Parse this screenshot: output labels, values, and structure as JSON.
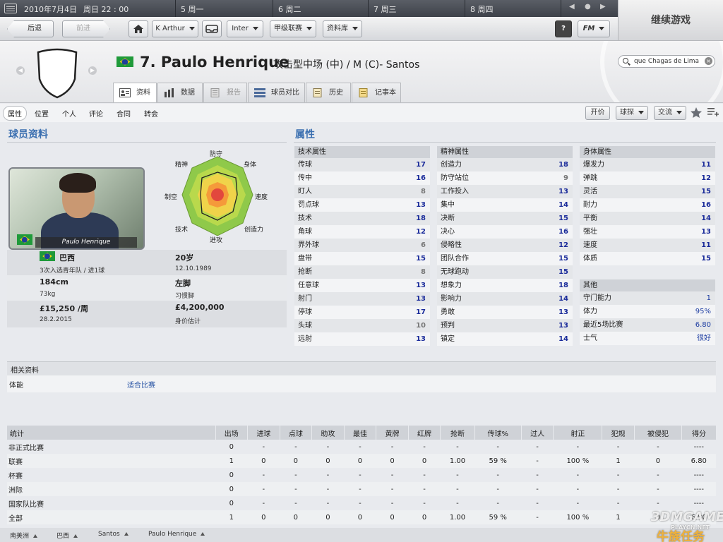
{
  "topbar": {
    "date": "2010年7月4日",
    "time": "周日 22 : 00",
    "days": [
      "5 周一",
      "6 周二",
      "7 周三",
      "8 周四"
    ],
    "continue_label": "继续游戏"
  },
  "toolbar": {
    "back": "后退",
    "forward": "前进",
    "manager": "K Arthur",
    "club": "Inter",
    "league": "甲级联赛",
    "database": "资料库",
    "help": "?",
    "fm": "FM"
  },
  "player": {
    "name": "7. Paulo Henrique",
    "position_club": "攻击型中场 (中) / M (C)- Santos",
    "photo_caption": "Paulo Henrique"
  },
  "search": {
    "value": "que Chagas de Lima"
  },
  "tabs": [
    "资料",
    "数据",
    "报告",
    "球员对比",
    "历史",
    "记事本"
  ],
  "subnav": {
    "items": [
      "属性",
      "位置",
      "个人",
      "评论",
      "合同",
      "转会"
    ],
    "offer": "开价",
    "scout": "球探",
    "interact": "交流"
  },
  "profile": {
    "title": "球员资料",
    "nationality": "巴西",
    "caps": "3次入选青年队 / 进1球",
    "age": "20岁",
    "dob": "12.10.1989",
    "height": "184cm",
    "weight": "73kg",
    "foot": "左脚",
    "foot_label": "习惯脚",
    "wage": "£15,250 /周",
    "contract_end": "28.2.2015",
    "value": "£4,200,000",
    "value_label": "身价估计"
  },
  "radar": {
    "labels": {
      "defend": "防守",
      "physical": "身体",
      "speed": "速度",
      "creativity": "创造力",
      "attack": "进攻",
      "technique": "技术",
      "aerial": "制空",
      "mental": "精神"
    }
  },
  "attributes": {
    "title": "属性",
    "technical": {
      "title": "技术属性",
      "items": [
        {
          "n": "传球",
          "v": "17"
        },
        {
          "n": "传中",
          "v": "16"
        },
        {
          "n": "盯人",
          "v": "8"
        },
        {
          "n": "罚点球",
          "v": "13"
        },
        {
          "n": "技术",
          "v": "18"
        },
        {
          "n": "角球",
          "v": "12"
        },
        {
          "n": "界外球",
          "v": "6"
        },
        {
          "n": "盘带",
          "v": "15"
        },
        {
          "n": "抢断",
          "v": "8"
        },
        {
          "n": "任意球",
          "v": "13"
        },
        {
          "n": "射门",
          "v": "13"
        },
        {
          "n": "停球",
          "v": "17"
        },
        {
          "n": "头球",
          "v": "10"
        },
        {
          "n": "远射",
          "v": "13"
        }
      ]
    },
    "mental": {
      "title": "精神属性",
      "items": [
        {
          "n": "创造力",
          "v": "18"
        },
        {
          "n": "防守站位",
          "v": "9"
        },
        {
          "n": "工作投入",
          "v": "13"
        },
        {
          "n": "集中",
          "v": "14"
        },
        {
          "n": "决断",
          "v": "15"
        },
        {
          "n": "决心",
          "v": "16"
        },
        {
          "n": "侵略性",
          "v": "12"
        },
        {
          "n": "团队合作",
          "v": "15"
        },
        {
          "n": "无球跑动",
          "v": "15"
        },
        {
          "n": "想象力",
          "v": "18"
        },
        {
          "n": "影响力",
          "v": "14"
        },
        {
          "n": "勇敢",
          "v": "13"
        },
        {
          "n": "预判",
          "v": "13"
        },
        {
          "n": "镇定",
          "v": "14"
        }
      ]
    },
    "physical": {
      "title": "身体属性",
      "items": [
        {
          "n": "爆发力",
          "v": "11"
        },
        {
          "n": "弹跳",
          "v": "12"
        },
        {
          "n": "灵活",
          "v": "15"
        },
        {
          "n": "耐力",
          "v": "16"
        },
        {
          "n": "平衡",
          "v": "14"
        },
        {
          "n": "强壮",
          "v": "13"
        },
        {
          "n": "速度",
          "v": "11"
        },
        {
          "n": "体质",
          "v": "15"
        }
      ]
    },
    "other": {
      "title": "其他",
      "items": [
        {
          "n": "守门能力",
          "v": "1"
        },
        {
          "n": "体力",
          "v": "95%"
        },
        {
          "n": "最近5场比赛",
          "v": "6.80"
        },
        {
          "n": "士气",
          "v": "很好"
        }
      ]
    }
  },
  "related": {
    "title": "相关资料",
    "label": "体能",
    "value": "适合比赛"
  },
  "stats": {
    "headers": [
      "统计",
      "出场",
      "进球",
      "点球",
      "助攻",
      "最佳",
      "黄牌",
      "红牌",
      "抢断",
      "传球%",
      "过人",
      "射正",
      "犯规",
      "被侵犯",
      "得分"
    ],
    "rows": [
      [
        "非正式比赛",
        "0",
        "-",
        "-",
        "-",
        "-",
        "-",
        "-",
        "-",
        "-",
        "-",
        "-",
        "-",
        "-",
        "----"
      ],
      [
        "联赛",
        "1",
        "0",
        "0",
        "0",
        "0",
        "0",
        "0",
        "1.00",
        "59 %",
        "-",
        "100 %",
        "1",
        "0",
        "6.80"
      ],
      [
        "杯赛",
        "0",
        "-",
        "-",
        "-",
        "-",
        "-",
        "-",
        "-",
        "-",
        "-",
        "-",
        "-",
        "-",
        "----"
      ],
      [
        "洲际",
        "0",
        "-",
        "-",
        "-",
        "-",
        "-",
        "-",
        "-",
        "-",
        "-",
        "-",
        "-",
        "-",
        "----"
      ],
      [
        "国家队比赛",
        "0",
        "-",
        "-",
        "-",
        "-",
        "-",
        "-",
        "-",
        "-",
        "-",
        "-",
        "-",
        "-",
        "----"
      ],
      [
        "全部",
        "1",
        "0",
        "0",
        "0",
        "0",
        "0",
        "0",
        "1.00",
        "59 %",
        "-",
        "100 %",
        "1",
        "0",
        "6.80"
      ]
    ]
  },
  "breadcrumbs": [
    "南美洲",
    "巴西",
    "Santos",
    "Paulo Henrique"
  ],
  "watermark": {
    "brand": "3DMGAME",
    "site": "PLAYCN.NET",
    "cn": "牛族任务"
  },
  "colors": {
    "accent": "#3a6fb0",
    "high_attr": "#1a2b9a"
  }
}
